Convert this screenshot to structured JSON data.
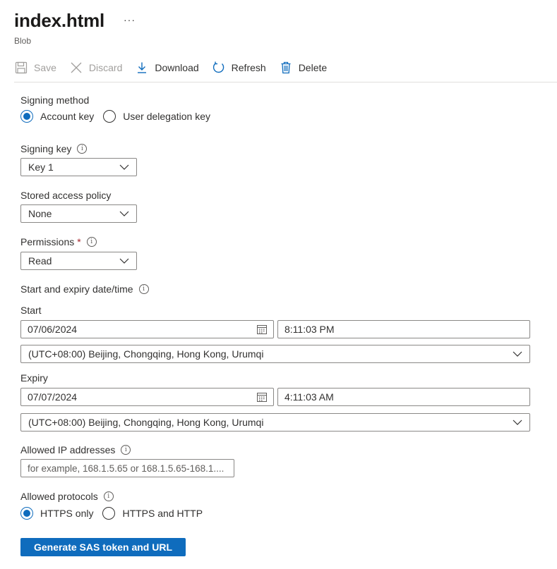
{
  "header": {
    "title": "index.html",
    "more_label": "···",
    "subtitle": "Blob"
  },
  "toolbar": {
    "save_label": "Save",
    "discard_label": "Discard",
    "download_label": "Download",
    "refresh_label": "Refresh",
    "delete_label": "Delete"
  },
  "form": {
    "signing_method": {
      "label": "Signing method",
      "options": [
        "Account key",
        "User delegation key"
      ],
      "selected": "Account key"
    },
    "signing_key": {
      "label": "Signing key",
      "value": "Key 1"
    },
    "stored_access_policy": {
      "label": "Stored access policy",
      "value": "None"
    },
    "permissions": {
      "label": "Permissions",
      "required_mark": "*",
      "value": "Read"
    },
    "datetime": {
      "label": "Start and expiry date/time",
      "start": {
        "label": "Start",
        "date": "07/06/2024",
        "time": "8:11:03 PM",
        "timezone": "(UTC+08:00) Beijing, Chongqing, Hong Kong, Urumqi"
      },
      "expiry": {
        "label": "Expiry",
        "date": "07/07/2024",
        "time": "4:11:03 AM",
        "timezone": "(UTC+08:00) Beijing, Chongqing, Hong Kong, Urumqi"
      }
    },
    "allowed_ip": {
      "label": "Allowed IP addresses",
      "placeholder": "for example, 168.1.5.65 or 168.1.5.65-168.1...."
    },
    "allowed_protocols": {
      "label": "Allowed protocols",
      "options": [
        "HTTPS only",
        "HTTPS and HTTP"
      ],
      "selected": "HTTPS only"
    },
    "generate_button": "Generate SAS token and URL"
  },
  "colors": {
    "accent": "#0f6cbd",
    "required": "#a4262c",
    "disabled_text": "#a19f9d",
    "border": "#8a8886"
  },
  "icons": {
    "save": "save-icon",
    "discard": "discard-icon",
    "download": "download-icon",
    "refresh": "refresh-icon",
    "delete": "delete-icon",
    "info": "info-icon",
    "chevron": "chevron-down-icon",
    "calendar": "calendar-icon"
  }
}
